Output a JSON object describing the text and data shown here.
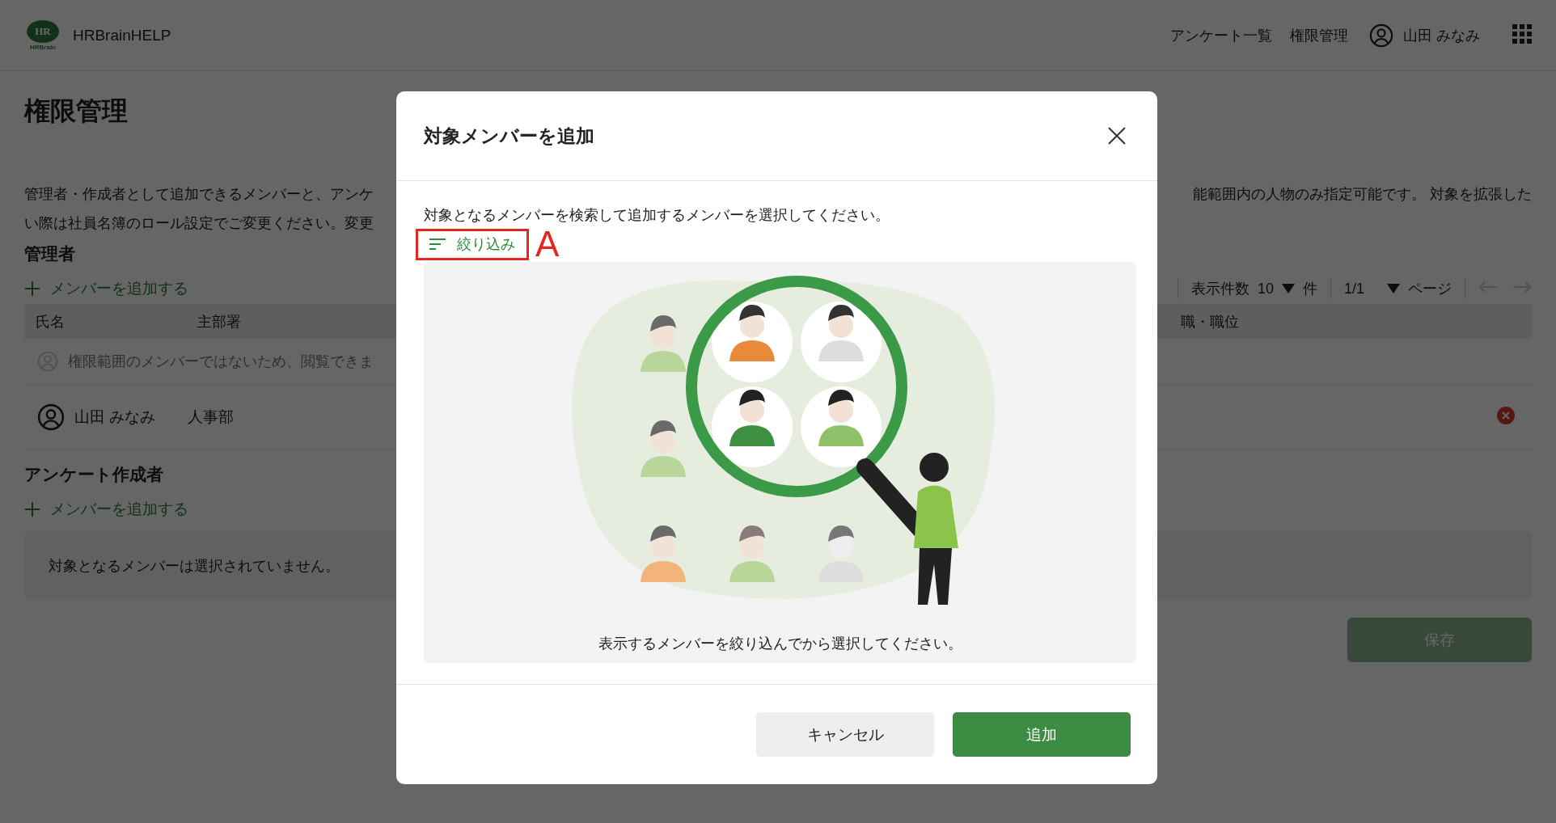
{
  "header": {
    "logo_text": "HR",
    "logo_sub": "HRBrain",
    "brand": "HRBrainHELP",
    "nav": [
      {
        "label": "アンケート一覧"
      },
      {
        "label": "権限管理"
      }
    ],
    "user": "山田 みなみ"
  },
  "page": {
    "title": "権限管理",
    "description_left": [
      "管理者・作成者として追加できるメンバーと、アンケ",
      "い際は社員名簿のロール設定でご変更ください。変更"
    ],
    "description_right": "能範囲内の人物のみ指定可能です。 対象を拡張した",
    "sections": [
      {
        "kind": "table",
        "heading": "管理者",
        "add_label": "メンバーを追加する",
        "pagination": {
          "per_page_label": "表示件数",
          "per_page": "10",
          "per_page_unit": "件",
          "page": "1/1",
          "page_unit": "ページ"
        },
        "columns": [
          "氏名",
          "主部署"
        ],
        "columns_right": [
          "職・職位"
        ],
        "notice": "権限範囲のメンバーではないため、閲覧できま",
        "rows": [
          {
            "name": "山田 みなみ",
            "department": "人事部"
          }
        ]
      },
      {
        "kind": "empty",
        "heading": "アンケート作成者",
        "add_label": "メンバーを追加する",
        "empty_text": "対象となるメンバーは選択されていません。"
      }
    ],
    "save_label": "保存"
  },
  "dialog": {
    "title": "対象メンバーを追加",
    "instruction": "対象となるメンバーを検索して追加するメンバーを選択してください。",
    "filter_label": "絞り込み",
    "annotation": "A",
    "caption": "表示するメンバーを絞り込んでから選択してください。",
    "buttons": [
      {
        "label": "キャンセル",
        "kind": "secondary"
      },
      {
        "label": "追加",
        "kind": "primary"
      }
    ]
  }
}
